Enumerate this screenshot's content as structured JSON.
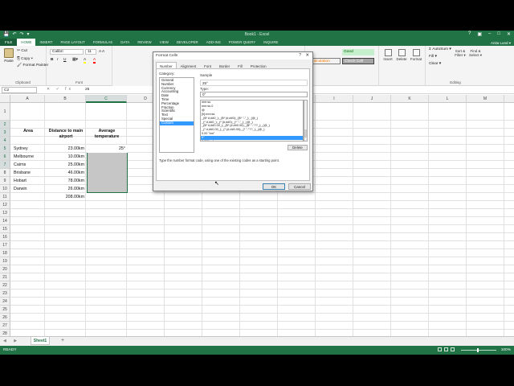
{
  "window": {
    "title": "Book1 - Excel",
    "quick_access": [
      "💾",
      "↶",
      "↷",
      "▾"
    ],
    "controls": [
      "?",
      "▣",
      "–",
      "□",
      "✕"
    ]
  },
  "ribbon_tabs": {
    "file": "FILE",
    "items": [
      "HOME",
      "INSERT",
      "PAGE LAYOUT",
      "FORMULAS",
      "DATA",
      "REVIEW",
      "VIEW",
      "DEVELOPER",
      "ADD-INS",
      "POWER QUERY",
      "INQUIRE"
    ],
    "user": "Anita Lund ▾"
  },
  "ribbon": {
    "clipboard": {
      "paste": "Paste",
      "cut": "Cut",
      "copy": "Copy ▾",
      "format_painter": "Format Painter",
      "label": "Clipboard"
    },
    "font": {
      "name": "Calibri",
      "size": "11",
      "grow": "A A",
      "bold": "B",
      "italic": "I",
      "underline": "U",
      "fill": "A",
      "color": "A",
      "label": "Font"
    },
    "styles": {
      "calculation": "Calculation",
      "check_cell": "Check Cell",
      "good": "Good"
    },
    "cells": {
      "insert": "Insert",
      "delete": "Delete",
      "format": "Format"
    },
    "editing": {
      "autosum": "Σ AutoSum ▾",
      "fill": "Fill ▾",
      "clear": "Clear ▾",
      "sort": "Sort & Filter ▾",
      "find": "Find & Select ▾",
      "label": "Editing"
    },
    "colors": {
      "good_bg": "#c6efce",
      "good_fg": "#006100",
      "calc_bg": "#f2f2f2",
      "calc_fg": "#fa7d00",
      "check_bg": "#a5a5a5",
      "check_fg": "#ffffff"
    }
  },
  "formula_bar": {
    "name_box": "C2",
    "fx": "✕ ✓ fx",
    "value": "25"
  },
  "grid": {
    "columns": [
      "A",
      "B",
      "C",
      "D",
      "E",
      "F",
      "G",
      "H",
      "I",
      "J",
      "K",
      "L",
      "M",
      "N"
    ],
    "rows": [
      "1",
      "2",
      "3",
      "4",
      "5",
      "6",
      "7",
      "8",
      "9",
      "10",
      "11",
      "12",
      "13",
      "14",
      "15",
      "16",
      "17",
      "18",
      "19",
      "20",
      "21",
      "22",
      "23",
      "24",
      "25",
      "26",
      "27",
      "28",
      "29"
    ],
    "header_a": "Area",
    "header_b": "Distance to main airport",
    "header_c": "Average temperature",
    "areas": [
      "Sydney",
      "Melbourne",
      "Cairns",
      "Brisbane",
      "Hobart",
      "Darwin"
    ],
    "distances": [
      "23.00km",
      "10.00km",
      "25.00km",
      "46.00km",
      "78.00km",
      "26.00km"
    ],
    "temp_c2": "25°",
    "total": "208.00km"
  },
  "sheets": {
    "nav": "◀ ▶",
    "active": "Sheet1",
    "add": "+"
  },
  "status": {
    "left": "READY",
    "zoom": "100%"
  },
  "dialog": {
    "title": "Format Cells",
    "help": "?",
    "close": "✕",
    "tabs": [
      "Number",
      "Alignment",
      "Font",
      "Border",
      "Fill",
      "Protection"
    ],
    "category_label": "Category:",
    "categories": [
      "General",
      "Number",
      "Currency",
      "Accounting",
      "Date",
      "Time",
      "Percentage",
      "Fraction",
      "Scientific",
      "Text",
      "Special",
      "Custom"
    ],
    "selected_category": "Custom",
    "sample_label": "Sample",
    "sample_value": "25°",
    "type_label": "Type:",
    "type_value": "0°",
    "formats": [
      "mm:ss",
      "mm:ss.0",
      "@",
      "[h]:mm:ss",
      "_($* #,##0_);_($* (#,##0);_($* \"-\"_);_(@_)",
      "_(* #,##0_);_(* (#,##0);_(* \"-\"_);_(@_)",
      "_($* #,##0.00_);_($* (#,##0.00);_($* \"-\"??_);_(@_)",
      "_(* #,##0.00_);_(* (#,##0.00);_(* \"-\"??_);_(@_)",
      "0.00 \"km\"",
      "0°",
      "0.00\"km\""
    ],
    "selected_format": "0°",
    "delete": "Delete",
    "hint": "Type the number format code, using one of the existing codes as a starting point.",
    "ok": "OK",
    "cancel": "Cancel"
  }
}
